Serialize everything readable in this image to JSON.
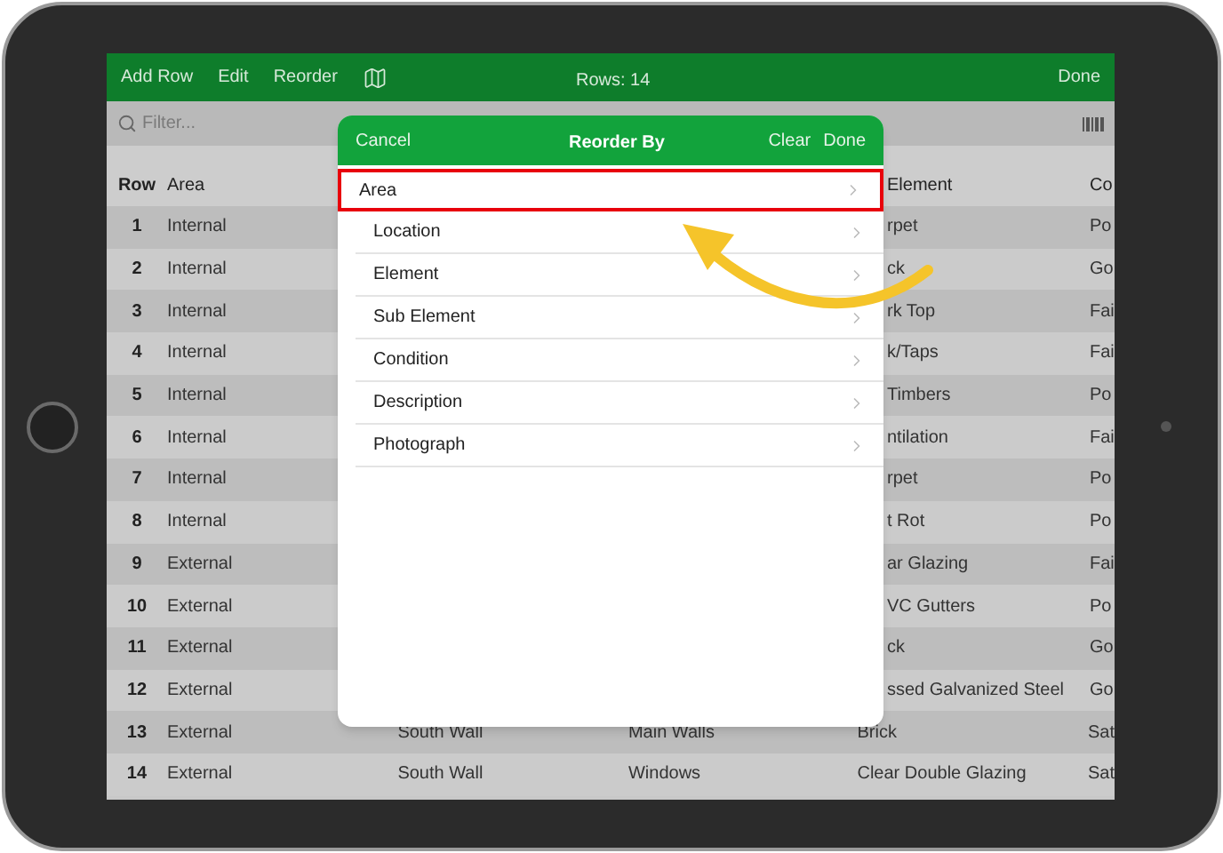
{
  "toolbar": {
    "buttons": [
      "Add Row",
      "Edit",
      "Reorder"
    ],
    "title": "Rows: 14",
    "done": "Done"
  },
  "filter": {
    "placeholder": "Filter..."
  },
  "table": {
    "columns": [
      "Row",
      "Area",
      "Element",
      "Co"
    ],
    "rows": [
      {
        "row": "1",
        "area": "Internal",
        "sub_element": "rpet",
        "condition": "Po"
      },
      {
        "row": "2",
        "area": "Internal",
        "sub_element": "ck",
        "condition": "Go"
      },
      {
        "row": "3",
        "area": "Internal",
        "sub_element": "rk Top",
        "condition": "Fai"
      },
      {
        "row": "4",
        "area": "Internal",
        "sub_element": "k/Taps",
        "condition": "Fai"
      },
      {
        "row": "5",
        "area": "Internal",
        "sub_element": "Timbers",
        "condition": "Po"
      },
      {
        "row": "6",
        "area": "Internal",
        "sub_element": "ntilation",
        "condition": "Fai"
      },
      {
        "row": "7",
        "area": "Internal",
        "sub_element": "rpet",
        "condition": "Po"
      },
      {
        "row": "8",
        "area": "Internal",
        "sub_element": "t Rot",
        "condition": "Po"
      },
      {
        "row": "9",
        "area": "External",
        "sub_element": "ar Glazing",
        "condition": "Fai"
      },
      {
        "row": "10",
        "area": "External",
        "sub_element": "VC Gutters",
        "condition": "Po"
      },
      {
        "row": "11",
        "area": "External",
        "sub_element": "ck",
        "condition": "Go"
      },
      {
        "row": "12",
        "area": "External",
        "sub_element": "ssed Galvanized Steel",
        "condition": "Go"
      },
      {
        "row": "13",
        "area": "External",
        "location": "South Wall",
        "element": "Main Walls",
        "sub_element": "Brick",
        "condition": "Sat"
      },
      {
        "row": "14",
        "area": "External",
        "location": "South Wall",
        "element": "Windows",
        "sub_element": "Clear Double Glazing",
        "condition": "Sat"
      }
    ]
  },
  "dialog": {
    "cancel": "Cancel",
    "title": "Reorder By",
    "clear": "Clear",
    "done": "Done",
    "options": [
      {
        "label": "Area",
        "selected": true
      },
      {
        "label": "Location",
        "selected": false
      },
      {
        "label": "Element",
        "selected": false
      },
      {
        "label": "Sub Element",
        "selected": false
      },
      {
        "label": "Condition",
        "selected": false
      },
      {
        "label": "Description",
        "selected": false
      },
      {
        "label": "Photograph",
        "selected": false
      }
    ]
  }
}
